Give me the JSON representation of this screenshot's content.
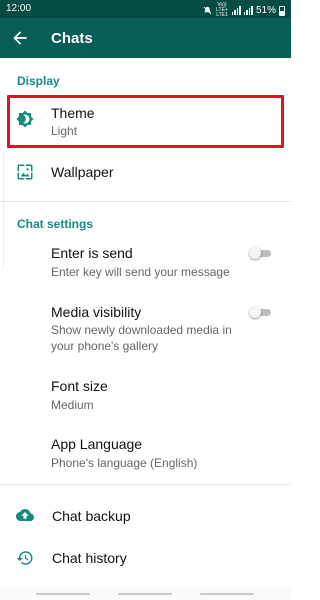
{
  "status_bar": {
    "time": "12:00",
    "network_label": "Vo)) LTE+ LTE1",
    "battery": "51%",
    "icons": [
      "mute-icon",
      "signal-icon",
      "battery-icon"
    ]
  },
  "app_bar": {
    "title": "Chats",
    "back_icon": "arrow-left-icon",
    "background": "#075e54"
  },
  "sections": {
    "display": {
      "header": "Display",
      "theme": {
        "label": "Theme",
        "value": "Light",
        "icon": "brightness-icon"
      },
      "wallpaper": {
        "label": "Wallpaper",
        "icon": "wallpaper-icon"
      }
    },
    "chat_settings": {
      "header": "Chat settings",
      "enter_is_send": {
        "label": "Enter is send",
        "description": "Enter key will send your message",
        "enabled": false
      },
      "media_visibility": {
        "label": "Media visibility",
        "description": "Show newly downloaded media in your phone's gallery",
        "enabled": false
      },
      "font_size": {
        "label": "Font size",
        "value": "Medium"
      },
      "app_language": {
        "label": "App Language",
        "value": "Phone's language (English)"
      }
    },
    "backup": {
      "chat_backup": {
        "label": "Chat backup",
        "icon": "cloud-upload-icon"
      },
      "chat_history": {
        "label": "Chat history",
        "icon": "history-icon"
      }
    }
  },
  "colors": {
    "accent": "#128c7e",
    "status_bar": "#054c44",
    "highlight_border": "#e0141e"
  }
}
